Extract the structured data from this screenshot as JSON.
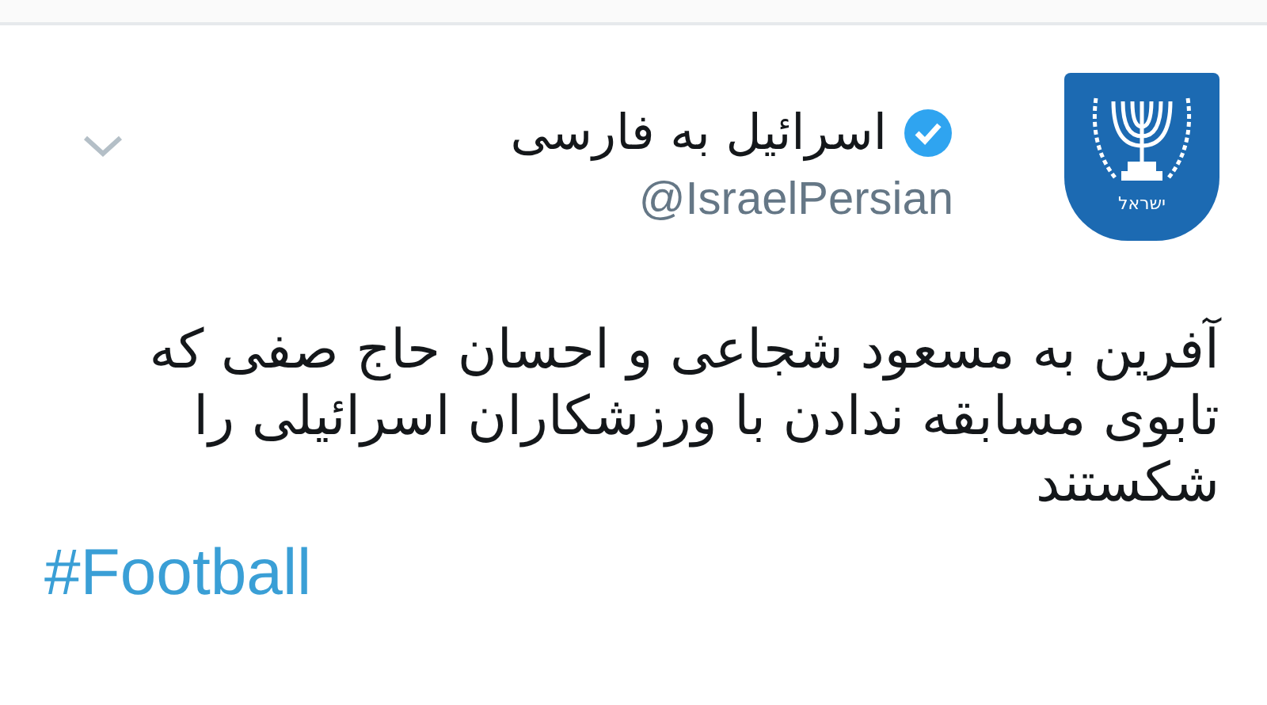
{
  "tweet": {
    "display_name": "اسرائیل به فارسی",
    "verified": true,
    "handle": "@IsraelPersian",
    "emblem_text": "ישראל",
    "text": "آفرین به مسعود شجاعی و احسان حاج صفی که تابوی مسابقه ندادن با ورزشکاران اسرائیلی را شکستند",
    "hashtag": "#Football"
  }
}
